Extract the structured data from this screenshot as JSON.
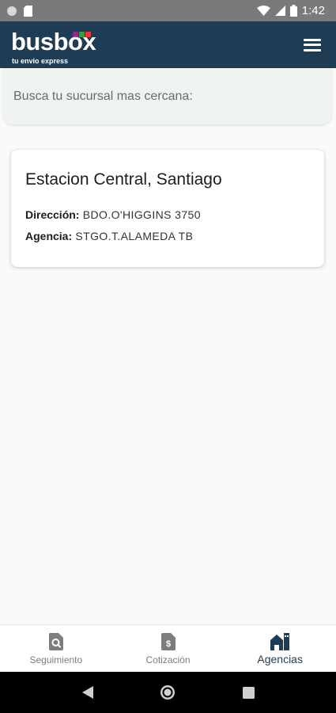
{
  "status_bar": {
    "time": "1:42"
  },
  "app_bar": {
    "logo_text": "busbox",
    "logo_tagline": "tu envio express",
    "logo_square_colors": [
      "#8a2a8c",
      "#3a9a4a",
      "#e23a3a"
    ],
    "bg_color": "#1e3d55"
  },
  "search": {
    "placeholder": "Busca tu sucursal mas cercana:"
  },
  "agencies": [
    {
      "name": "Estacion Central, Santiago",
      "address_label": "Dirección:",
      "address_value": "BDO.O'HIGGINS 3750",
      "agency_label": "Agencia:",
      "agency_value": "STGO.T.ALAMEDA TB"
    }
  ],
  "bottom_nav": {
    "items": [
      {
        "label": "Seguimiento",
        "icon": "search-document-icon",
        "active": false
      },
      {
        "label": "Cotización",
        "icon": "dollar-document-icon",
        "active": false
      },
      {
        "label": "Agencias",
        "icon": "house-icon",
        "active": true
      }
    ]
  },
  "system_nav": {
    "buttons": [
      "back-icon",
      "home-icon",
      "recents-icon"
    ]
  }
}
